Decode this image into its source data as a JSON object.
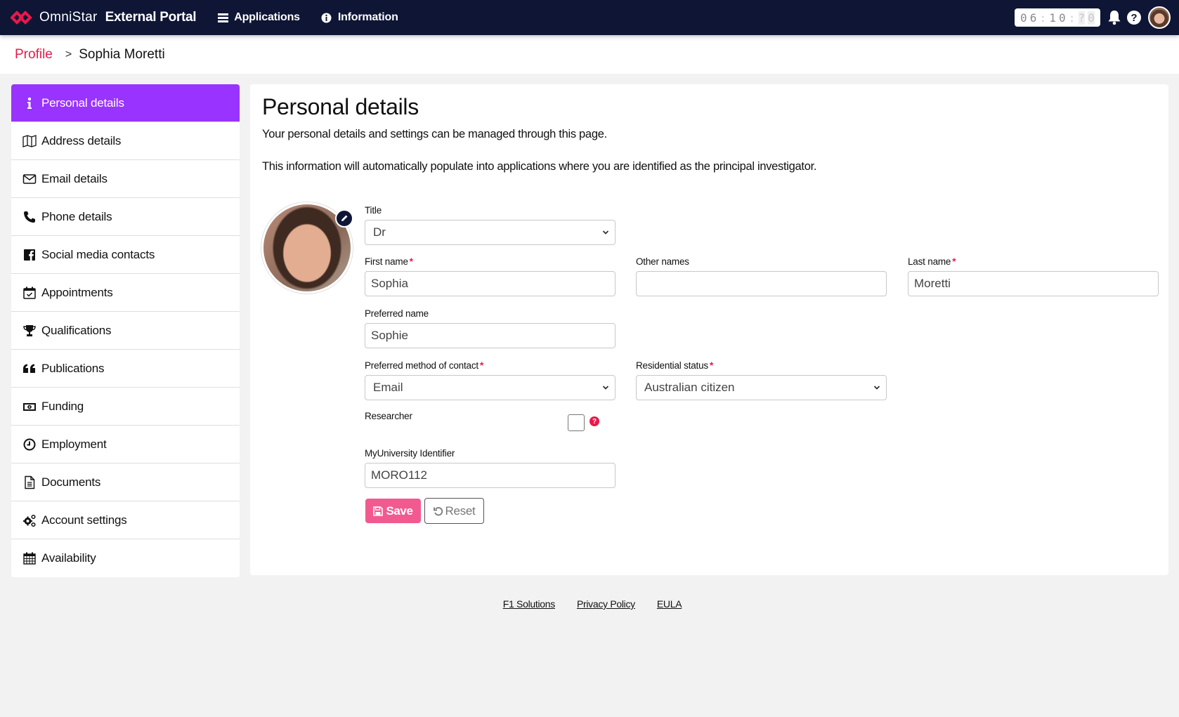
{
  "app": {
    "brand": "OmniStar",
    "portal_name": "External Portal",
    "brand_color": "#e8194a",
    "nav_bg": "#0e1535",
    "accent": "#9933ff"
  },
  "topnav": {
    "items": [
      {
        "label": "Applications",
        "icon": "list-icon"
      },
      {
        "label": "Information",
        "icon": "info-circle-icon"
      }
    ],
    "clock": {
      "h1": "0",
      "h2": "6",
      "m1": "1",
      "m2": "0",
      "s1": "?",
      "s2": "0"
    }
  },
  "breadcrumb": {
    "root": "Profile",
    "separator": ">",
    "current": "Sophia Moretti"
  },
  "sidebar": {
    "items": [
      {
        "label": "Personal details",
        "icon": "info-icon",
        "active": true
      },
      {
        "label": "Address details",
        "icon": "map-icon"
      },
      {
        "label": "Email details",
        "icon": "envelope-icon"
      },
      {
        "label": "Phone details",
        "icon": "phone-icon"
      },
      {
        "label": "Social media contacts",
        "icon": "facebook-icon"
      },
      {
        "label": "Appointments",
        "icon": "calendar-check-icon"
      },
      {
        "label": "Qualifications",
        "icon": "trophy-icon"
      },
      {
        "label": "Publications",
        "icon": "quote-icon"
      },
      {
        "label": "Funding",
        "icon": "money-bill-icon"
      },
      {
        "label": "Employment",
        "icon": "clock-icon"
      },
      {
        "label": "Documents",
        "icon": "document-icon"
      },
      {
        "label": "Account settings",
        "icon": "cogs-icon"
      },
      {
        "label": "Availability",
        "icon": "calendar-icon"
      }
    ]
  },
  "main": {
    "title": "Personal details",
    "intro1": "Your personal details and settings can be managed through this page.",
    "intro2": "This information will automatically populate into applications where you are identified as the principal investigator.",
    "form": {
      "title": {
        "label": "Title",
        "value": "Dr"
      },
      "first_name": {
        "label": "First name",
        "value": "Sophia",
        "required": "*"
      },
      "other_names": {
        "label": "Other names",
        "value": ""
      },
      "last_name": {
        "label": "Last name",
        "value": "Moretti",
        "required": "*"
      },
      "preferred_name": {
        "label": "Preferred name",
        "value": "Sophie"
      },
      "contact_method": {
        "label": "Preferred method of contact",
        "value": "Email",
        "required": "*"
      },
      "residential_status": {
        "label": "Residential status",
        "value": "Australian citizen",
        "required": "*"
      },
      "researcher": {
        "label": "Researcher",
        "checked": false,
        "help": "?"
      },
      "university_id": {
        "label": "MyUniversity Identifier",
        "value": "MORO112"
      }
    },
    "buttons": {
      "save": "Save",
      "reset": "Reset"
    }
  },
  "footer": {
    "links": [
      "F1 Solutions",
      "Privacy Policy",
      "EULA"
    ]
  }
}
